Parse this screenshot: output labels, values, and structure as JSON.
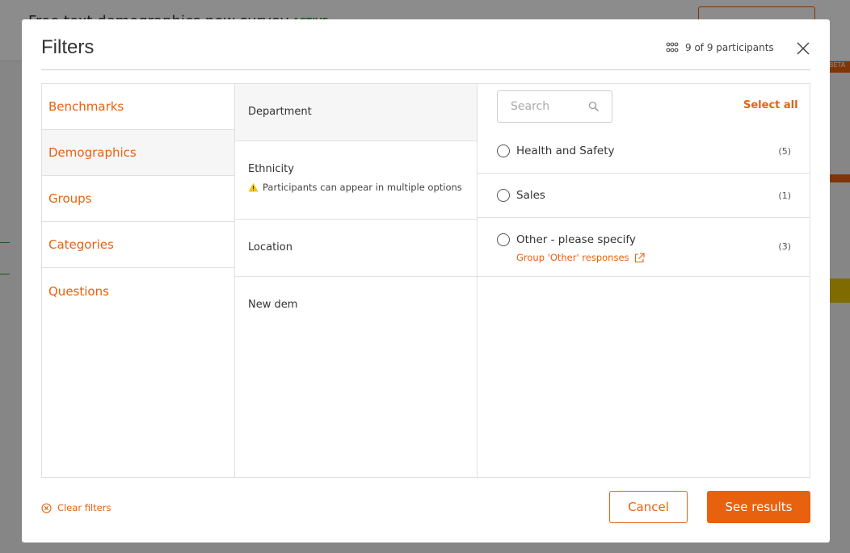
{
  "background": {
    "title": "Free text demographics new survey",
    "status": "ACTIVE",
    "beta_badge": "BETA"
  },
  "modal": {
    "title": "Filters",
    "participants": "9 of 9 participants",
    "close_icon": "close-icon",
    "categories": [
      {
        "label": "Benchmarks"
      },
      {
        "label": "Demographics"
      },
      {
        "label": "Groups"
      },
      {
        "label": "Categories"
      },
      {
        "label": "Questions"
      }
    ],
    "active_category": "Demographics",
    "demographics": [
      {
        "label": "Department"
      },
      {
        "label": "Ethnicity",
        "note": "Participants can appear in multiple options"
      },
      {
        "label": "Location"
      },
      {
        "label": "New dem"
      }
    ],
    "active_demographic": "Department",
    "search": {
      "placeholder": "Search",
      "value": ""
    },
    "select_all": "Select all",
    "options": [
      {
        "label": "Health and Safety",
        "count": "(5)"
      },
      {
        "label": "Sales",
        "count": "(1)"
      },
      {
        "label": "Other - please specify",
        "count": "(3)",
        "sub_link": "Group 'Other' responses"
      }
    ],
    "footer": {
      "clear_filters": "Clear filters",
      "cancel": "Cancel",
      "see_results": "See results"
    },
    "colors": {
      "accent": "#e8610e",
      "warning": "#f0c419"
    }
  }
}
